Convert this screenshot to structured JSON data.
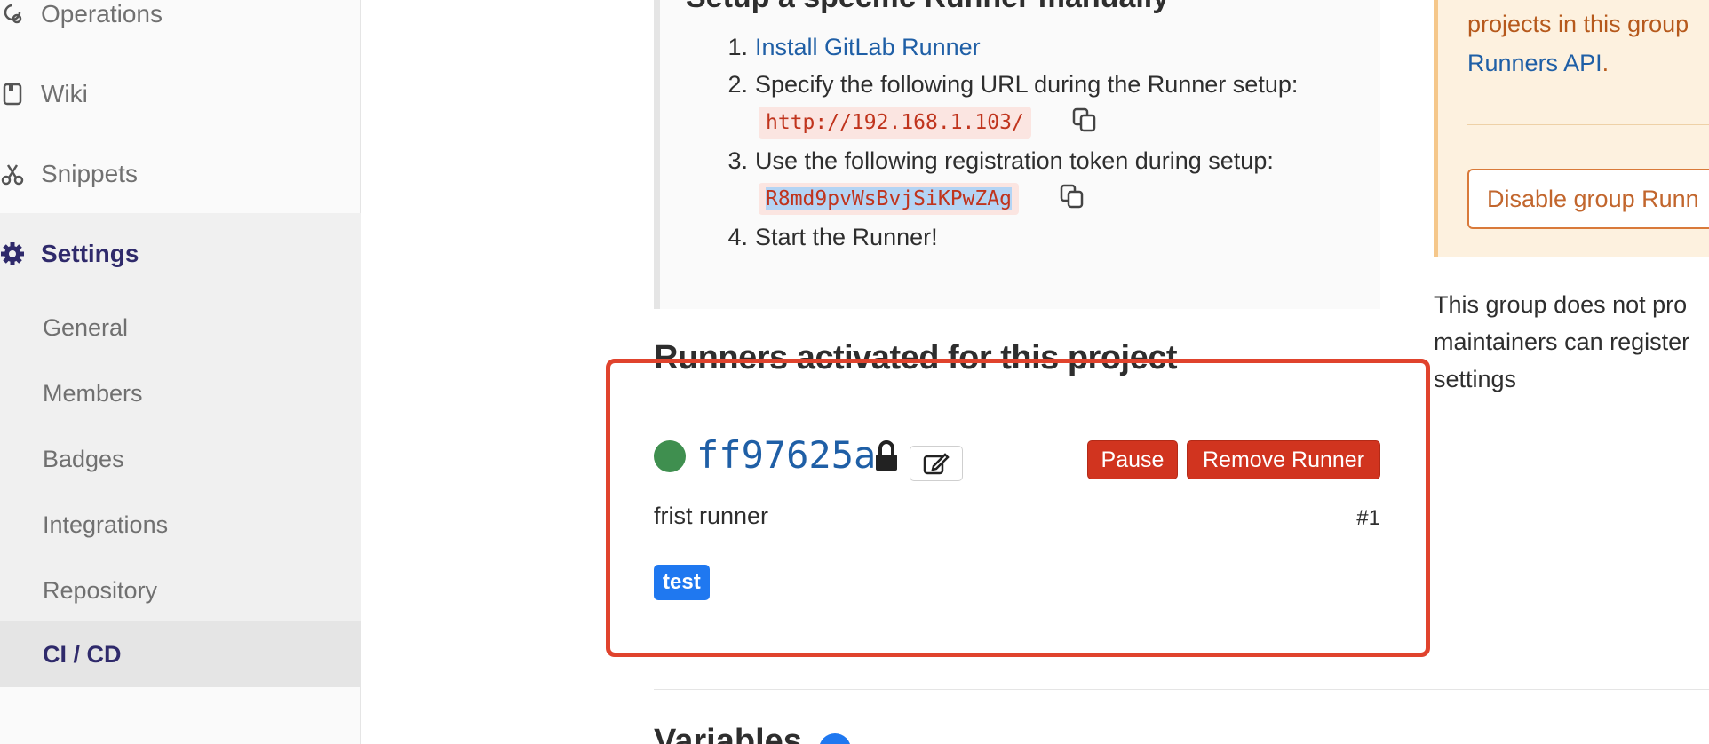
{
  "sidebar": {
    "items": [
      {
        "label": "Operations",
        "icon": "operations-icon"
      },
      {
        "label": "Wiki",
        "icon": "book-icon"
      },
      {
        "label": "Snippets",
        "icon": "scissors-icon"
      }
    ],
    "settings": {
      "label": "Settings",
      "icon": "gear-icon"
    },
    "sub_items": [
      "General",
      "Members",
      "Badges",
      "Integrations",
      "Repository",
      "CI / CD"
    ],
    "active": "CI / CD"
  },
  "setup": {
    "title": "Setup a specific Runner manually",
    "steps": [
      {
        "num": "1.",
        "link": "Install GitLab Runner"
      },
      {
        "num": "2.",
        "text": "Specify the following URL during the Runner setup:",
        "code": "http://192.168.1.103/"
      },
      {
        "num": "3.",
        "text": "Use the following registration token during setup:",
        "code": "R8md9pvWsBvjSiKPwZAg"
      },
      {
        "num": "4.",
        "text": "Start the Runner!"
      }
    ]
  },
  "activated": {
    "title": "Runners activated for this project",
    "runner": {
      "id": "ff97625a",
      "description": "frist runner",
      "number": "#1",
      "tag": "test",
      "pause_label": "Pause",
      "remove_label": "Remove Runner",
      "status_color": "#3f8f4f"
    }
  },
  "variables": {
    "title": "Variables"
  },
  "right_panel": {
    "warning_line1": "projects in this group",
    "warning_link": "Runners API",
    "warning_after_link": ".",
    "disable_button": "Disable group Runn",
    "info_line1": "This group does not pro",
    "info_line2": "maintainers can register",
    "info_link": "settings"
  },
  "colors": {
    "link": "#1f5fa6",
    "danger": "#d1341f",
    "tag": "#1f78f0",
    "highlight_annotation": "#e0432d"
  }
}
